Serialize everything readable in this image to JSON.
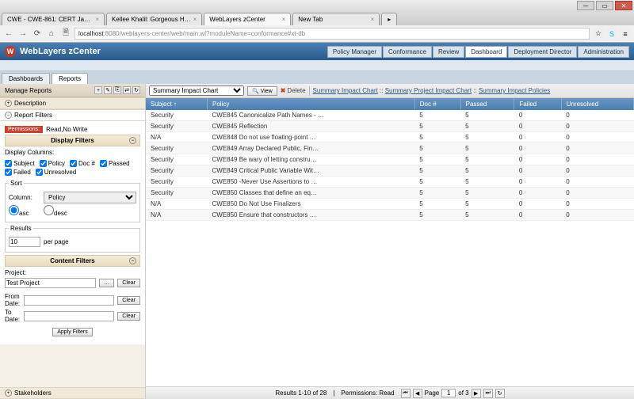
{
  "browser": {
    "tabs": [
      {
        "title": "CWE - CWE-861: CERT Jav…"
      },
      {
        "title": "Kellee Khalil: Gorgeous H…"
      },
      {
        "title": "WebLayers zCenter",
        "active": true
      },
      {
        "title": "New Tab"
      }
    ],
    "url_host": "localhost",
    "url_port": ":8080",
    "url_path": "/weblayers-center/web/main.wl?moduleName=conformance#xt-db"
  },
  "app": {
    "title": "WebLayers zCenter",
    "nav": [
      "Policy Manager",
      "Conformance",
      "Review",
      "Dashboard",
      "Deployment Director",
      "Administration"
    ],
    "nav_active": "Dashboard",
    "subtabs": [
      "Dashboards",
      "Reports"
    ],
    "subtab_active": "Reports"
  },
  "sidebar": {
    "title": "Manage Reports",
    "sections": {
      "description": "Description",
      "report_filters": "Report Filters",
      "stakeholders": "Stakeholders"
    },
    "permissions_label": "Permissions:",
    "permissions_value": "Read,No Write",
    "display_filters": "Display Filters",
    "display_columns_label": "Display Columns:",
    "columns": [
      "Subject",
      "Policy",
      "Doc #",
      "Passed",
      "Failed",
      "Unresolved"
    ],
    "sort_legend": "Sort",
    "column_label": "Column:",
    "sort_column": "Policy",
    "asc": "asc",
    "desc": "desc",
    "results_legend": "Results",
    "results_count": "10",
    "per_page": "per page",
    "content_filters": "Content Filters",
    "project_label": "Project:",
    "project_value": "Test Project",
    "from_date": "From Date:",
    "to_date": "To Date:",
    "clear": "Clear",
    "apply": "Apply Filters",
    "browse": "…"
  },
  "content": {
    "dropdown": "Summary Impact Chart",
    "view": "View",
    "delete": "Delete",
    "link1": "Summary Impact Chart",
    "link2": "Summary Project Impact Chart",
    "link3": "Summary Impact Policies",
    "sep": " :: ",
    "headers": [
      "Subject ↑",
      "Policy",
      "Doc #",
      "Passed",
      "Failed",
      "Unresolved"
    ],
    "rows": [
      {
        "c": [
          "Security",
          "CWE845 Canonicalize Path Names - …",
          "5",
          "5",
          "0",
          "0"
        ]
      },
      {
        "c": [
          "Security",
          "CWE845 Reflection",
          "5",
          "5",
          "0",
          "0"
        ]
      },
      {
        "c": [
          "N/A",
          "CWE848 Do not use floating-point …",
          "5",
          "5",
          "0",
          "0"
        ]
      },
      {
        "c": [
          "Security",
          "CWE849 Array Declared Public, Fin…",
          "5",
          "5",
          "0",
          "0"
        ]
      },
      {
        "c": [
          "Security",
          "CWE849 Be wary of letting constru…",
          "5",
          "5",
          "0",
          "0"
        ]
      },
      {
        "c": [
          "Security",
          "CWE849 Critical Public Variable Wit…",
          "5",
          "5",
          "0",
          "0"
        ]
      },
      {
        "c": [
          "Security",
          "CWE850 -Never Use Assertions to …",
          "5",
          "5",
          "0",
          "0"
        ]
      },
      {
        "c": [
          "Security",
          "CWE850 Classes that define an eq…",
          "5",
          "5",
          "0",
          "0"
        ]
      },
      {
        "c": [
          "N/A",
          "CWE850 Do Not Use Finalizers",
          "5",
          "5",
          "0",
          "0"
        ]
      },
      {
        "c": [
          "N/A",
          "CWE850 Ensure that constructors …",
          "5",
          "5",
          "0",
          "0"
        ]
      }
    ]
  },
  "status": {
    "results": "Results 1-10 of 28",
    "perms": "Permissions: Read",
    "page_label": "Page",
    "page": "1",
    "of": "of 3"
  }
}
